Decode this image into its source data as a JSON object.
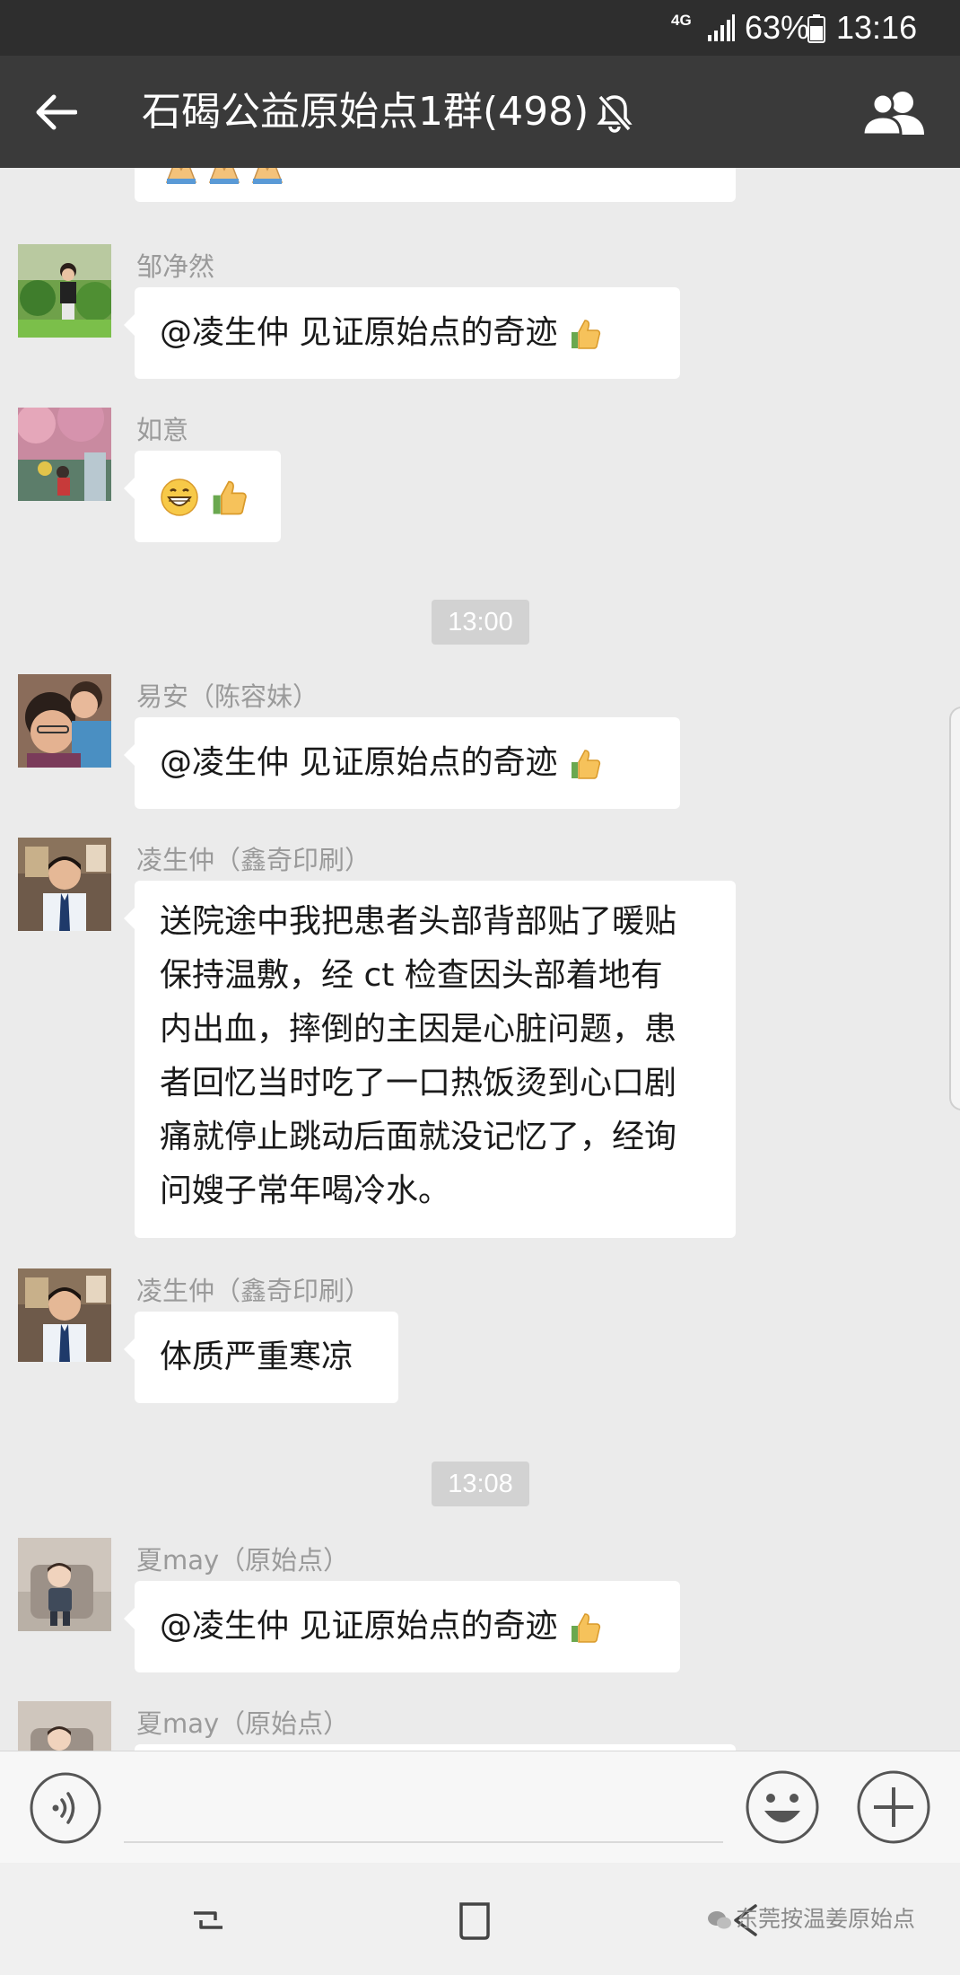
{
  "status_bar": {
    "network": "4G",
    "battery": "63%",
    "time": "13:16"
  },
  "header": {
    "title": "石碣公益原始点1群(498)"
  },
  "messages": [
    {
      "name": "",
      "text": ""
    },
    {
      "name": "邹净然",
      "text": "@凌生仲  见证原始点的奇迹"
    },
    {
      "name": "如意",
      "text": ""
    },
    {
      "name": "易安（陈容妹）",
      "text": "@凌生仲  见证原始点的奇迹"
    },
    {
      "name": "凌生仲（鑫奇印刷）",
      "lines": [
        "送院途中我把患者头部背部贴了暖贴",
        "保持温敷，经 ct 检查因头部着地有",
        "内出血，摔倒的主因是心脏问题，患",
        "者回忆当时吃了一口热饭烫到心口剧",
        "痛就停止跳动后面就没记忆了，经询",
        "问嫂子常年喝冷水。"
      ]
    },
    {
      "name": "凌生仲（鑫奇印刷）",
      "text": "体质严重寒凉"
    },
    {
      "name": "夏may（原始点）",
      "text": "@凌生仲  见证原始点的奇迹"
    },
    {
      "name": "夏may（原始点）",
      "text": ""
    }
  ],
  "timestamps": [
    "13:00",
    "13:08"
  ],
  "icons": {
    "emoji_pray": "folded-hands",
    "emoji_thumbs": "thumbs-up",
    "emoji_grin": "grinning-face"
  },
  "watermark": "东莞按温姜原始点",
  "colors": {
    "status_bar": "#2e2e2e",
    "title_bar": "#3a3a3a",
    "chat_bg": "#ebebeb",
    "bubble": "#ffffff",
    "name_text": "#9a9a9a",
    "time_pill": "#d2d2d2"
  }
}
